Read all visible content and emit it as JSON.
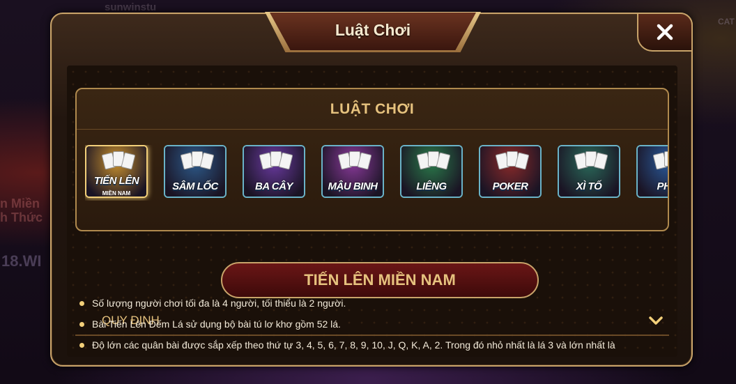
{
  "background": {
    "texts": [
      "sunwinstu",
      "n Miền",
      "h Thức",
      "18.WI",
      "CAT"
    ]
  },
  "modal": {
    "title": "Luật Chơi",
    "close_icon": "close-icon"
  },
  "panel": {
    "title": "LUẬT CHƠI"
  },
  "games": [
    {
      "label": "TIẾN LÊN",
      "sublabel": "MIỀN NAM",
      "active": true,
      "color": "#c8902e"
    },
    {
      "label": "SÂM LỐC",
      "sublabel": "",
      "active": false,
      "color": "#2d5a8a"
    },
    {
      "label": "BA CÂY",
      "sublabel": "",
      "active": false,
      "color": "#6a3aa0"
    },
    {
      "label": "MẬU BINH",
      "sublabel": "",
      "active": false,
      "color": "#8a3a9a"
    },
    {
      "label": "LIÊNG",
      "sublabel": "",
      "active": false,
      "color": "#2a7a4a"
    },
    {
      "label": "POKER",
      "sublabel": "",
      "active": false,
      "color": "#8a2a2a"
    },
    {
      "label": "XÌ TỐ",
      "sublabel": "",
      "active": false,
      "color": "#2a6a5a"
    },
    {
      "label": "PHỎ",
      "sublabel": "",
      "active": false,
      "color": "#2a5a9a"
    }
  ],
  "selected_game": "TIẾN LÊN MIỀN NAM",
  "section": {
    "title": "QUY ĐỊNH",
    "chevron_icon": "chevron-down-icon"
  },
  "rules": [
    "Số lượng người chơi tối đa là 4 người, tối thiểu là 2 người.",
    "Bài Tiến Lên Đếm Lá sử dụng bộ bài tú lơ khơ gồm 52 lá.",
    "Độ lớn các quân bài được sắp xếp theo thứ tự 3, 4, 5, 6, 7, 8, 9, 10, J, Q, K, A, 2. Trong đó nhỏ nhất là lá 3 và lớn nhất là"
  ],
  "colors": {
    "gold": "#e6c27e",
    "border": "#c9a46a",
    "red_bar": "#6a1616"
  }
}
